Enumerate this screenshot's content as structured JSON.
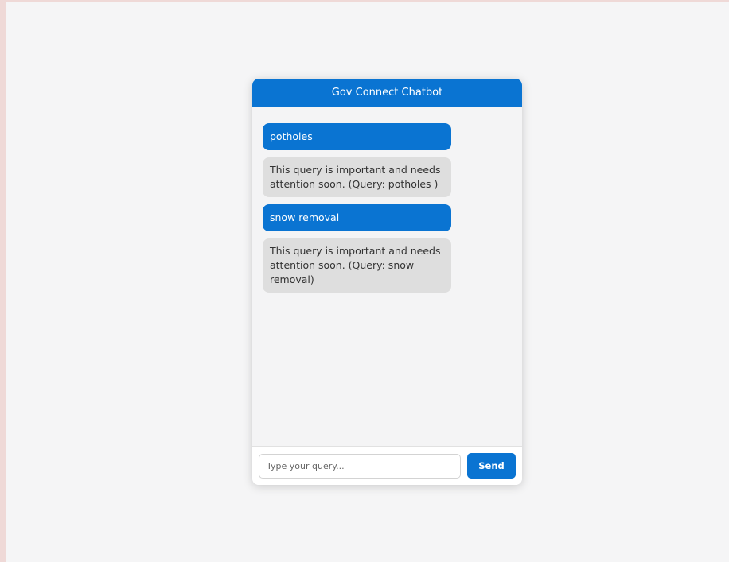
{
  "chatbot": {
    "title": "Gov Connect Chatbot",
    "messages": [
      {
        "role": "user",
        "text": "potholes"
      },
      {
        "role": "bot",
        "text": "This query is important and needs attention soon. (Query: potholes )"
      },
      {
        "role": "user",
        "text": "snow removal"
      },
      {
        "role": "bot",
        "text": "This query is important and needs attention soon. (Query: snow removal)"
      }
    ],
    "input": {
      "value": "",
      "placeholder": "Type your query..."
    },
    "send_label": "Send"
  },
  "colors": {
    "accent": "#0a74d2",
    "bot_bubble": "#dedede",
    "page_background": "#f5f5f6",
    "outer_background": "#efd9d7"
  }
}
